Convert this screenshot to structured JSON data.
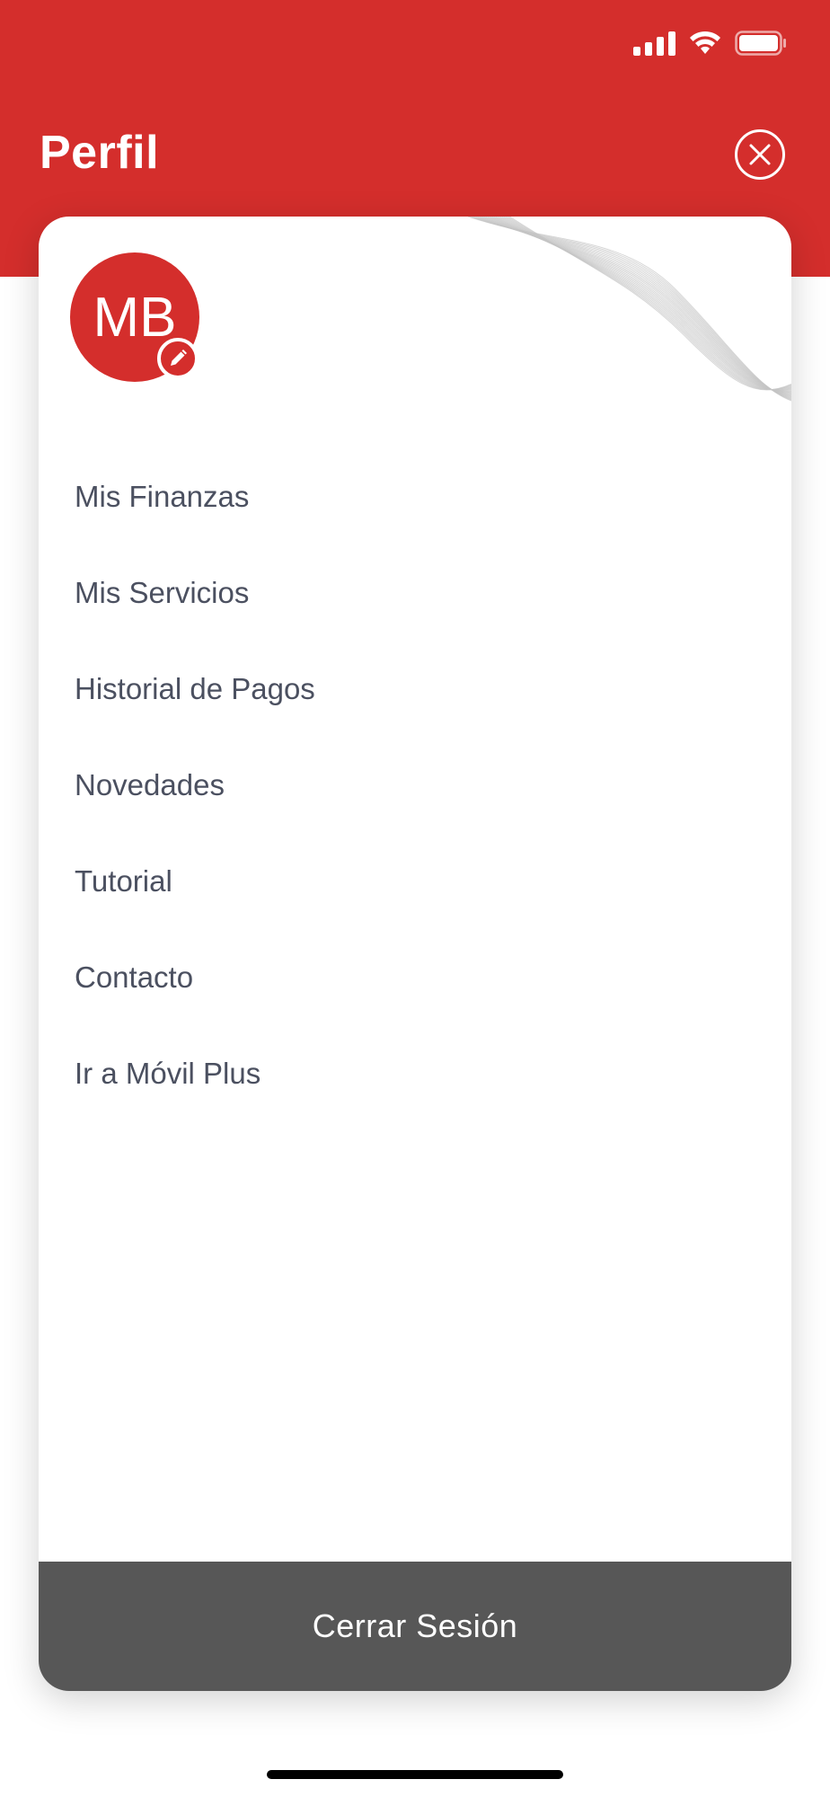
{
  "header": {
    "title": "Perfil",
    "accent_color": "#d42e2c"
  },
  "profile": {
    "initials": "MB"
  },
  "menu": {
    "items": [
      {
        "label": "Mis Finanzas"
      },
      {
        "label": "Mis Servicios"
      },
      {
        "label": "Historial de Pagos"
      },
      {
        "label": "Novedades"
      },
      {
        "label": "Tutorial"
      },
      {
        "label": "Contacto"
      },
      {
        "label": "Ir a Móvil Plus"
      }
    ]
  },
  "footer": {
    "logout_label": "Cerrar Sesión",
    "logout_color": "#575757"
  },
  "icons": {
    "close": "close-icon",
    "edit": "pencil-icon",
    "signal": "signal-icon",
    "wifi": "wifi-icon",
    "battery": "battery-icon"
  }
}
